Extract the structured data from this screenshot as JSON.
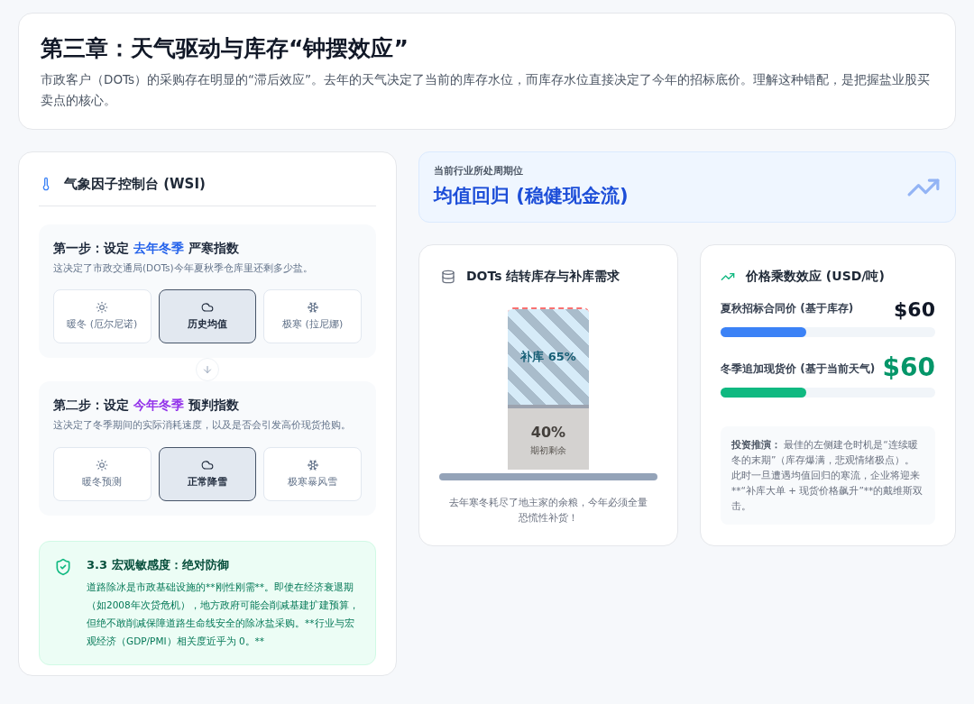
{
  "header": {
    "title": "第三章：天气驱动与库存“钟摆效应”",
    "description": "市政客户（DOTs）的采购存在明显的“滞后效应”。去年的天气决定了当前的库存水位，而库存水位直接决定了今年的招标底价。理解这种错配，是把握盐业股买卖点的核心。"
  },
  "console": {
    "title": "气象因子控制台 (WSI)",
    "steps": [
      {
        "prefix": "第一步：设定",
        "highlight": "去年冬季",
        "suffix": "严寒指数",
        "color": "#2563eb",
        "description": "这决定了市政交通局(DOTs)今年夏秋季仓库里还剩多少盐。",
        "options": [
          {
            "kind": "sun",
            "label": "暖冬 (厄尔尼诺)",
            "selected": false
          },
          {
            "kind": "cloud",
            "label": "历史均值",
            "selected": true
          },
          {
            "kind": "snow",
            "label": "极寒 (拉尼娜)",
            "selected": false
          }
        ]
      },
      {
        "prefix": "第二步：设定",
        "highlight": "今年冬季",
        "suffix": "预判指数",
        "color": "#9333ea",
        "description": "这决定了冬季期间的实际消耗速度，以及是否会引发高价现货抢购。",
        "options": [
          {
            "kind": "sun",
            "label": "暖冬预测",
            "selected": false
          },
          {
            "kind": "cloud",
            "label": "正常降雪",
            "selected": true
          },
          {
            "kind": "snow",
            "label": "极寒暴风雪",
            "selected": false
          }
        ]
      }
    ],
    "macro": {
      "title": "3.3 宏观敏感度：绝对防御",
      "text": "道路除冰是市政基础设施的**刚性刚需**。即使在经济衰退期（如2008年次贷危机），地方政府可能会削减基建扩建预算，但绝不敢削减保障道路生命线安全的除冰盐采购。**行业与宏观经济（GDP/PMI）相关度近乎为 0。**"
    }
  },
  "cycle": {
    "label": "当前行业所处周期位",
    "value": "均值回归 (稳健现金流)"
  },
  "inventory": {
    "title": "DOTs 结转库存与补库需求",
    "refill": {
      "label": "补库 65%",
      "level": 0.65
    },
    "remaining": {
      "value": "40%",
      "label": "期初剩余",
      "level": 0.4
    },
    "caption": "去年寒冬耗尽了地主家的余粮，今年必须全量恐慌性补货！"
  },
  "prices": {
    "title": "价格乘数效应 (USD/吨)",
    "items": [
      {
        "label": "夏秋招标合同价 (基于库存)",
        "value": "$60",
        "color": "#3b82f6",
        "level": 0.4
      },
      {
        "label": "冬季追加现货价 (基于当前天气)",
        "value": "$60",
        "color": "#10b981",
        "level": 0.4
      }
    ],
    "note": {
      "label": "投资推演：",
      "text": "最佳的左侧建仓时机是“连续暖冬的末期”（库存爆满，悲观情绪极点）。此时一旦遭遇均值回归的寒流，企业将迎来**“补库大单 + 现货价格飙升”**的戴维斯双击。"
    }
  }
}
